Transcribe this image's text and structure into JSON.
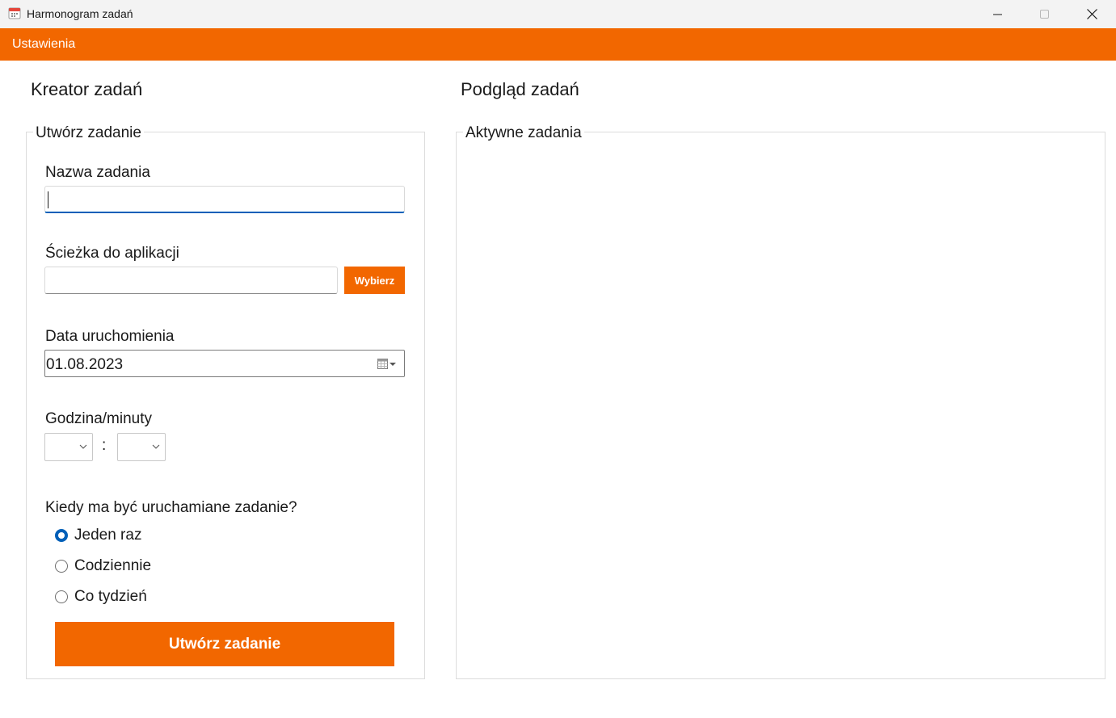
{
  "window": {
    "title": "Harmonogram zadań"
  },
  "menu": {
    "settings_label": "Ustawienia"
  },
  "creator": {
    "heading": "Kreator zadań",
    "group_title": "Utwórz zadanie",
    "task_name_label": "Nazwa zadania",
    "task_name_value": "",
    "app_path_label": "Ścieżka do aplikacji",
    "app_path_value": "",
    "browse_button": "Wybierz",
    "date_label": "Data uruchomienia",
    "date_value": "01.08.2023",
    "time_label": "Godzina/minuty",
    "hour_value": "",
    "minute_value": "",
    "time_separator": ":",
    "frequency_label": "Kiedy ma być uruchamiane zadanie?",
    "frequency_options": [
      {
        "label": "Jeden raz",
        "checked": true
      },
      {
        "label": "Codziennie",
        "checked": false
      },
      {
        "label": "Co tydzień",
        "checked": false
      }
    ],
    "create_button": "Utwórz zadanie"
  },
  "preview": {
    "heading": "Podgląd zadań",
    "group_title": "Aktywne zadania"
  },
  "colors": {
    "accent": "#f26700",
    "focus": "#005fb8",
    "titlebar": "#f3f3f3"
  },
  "icons": {
    "app": "calendar-icon",
    "minimize": "minimize-icon",
    "maximize": "maximize-icon",
    "close": "close-icon",
    "date_dropdown": "calendar-dropdown-icon",
    "combo": "chevron-down-icon"
  }
}
